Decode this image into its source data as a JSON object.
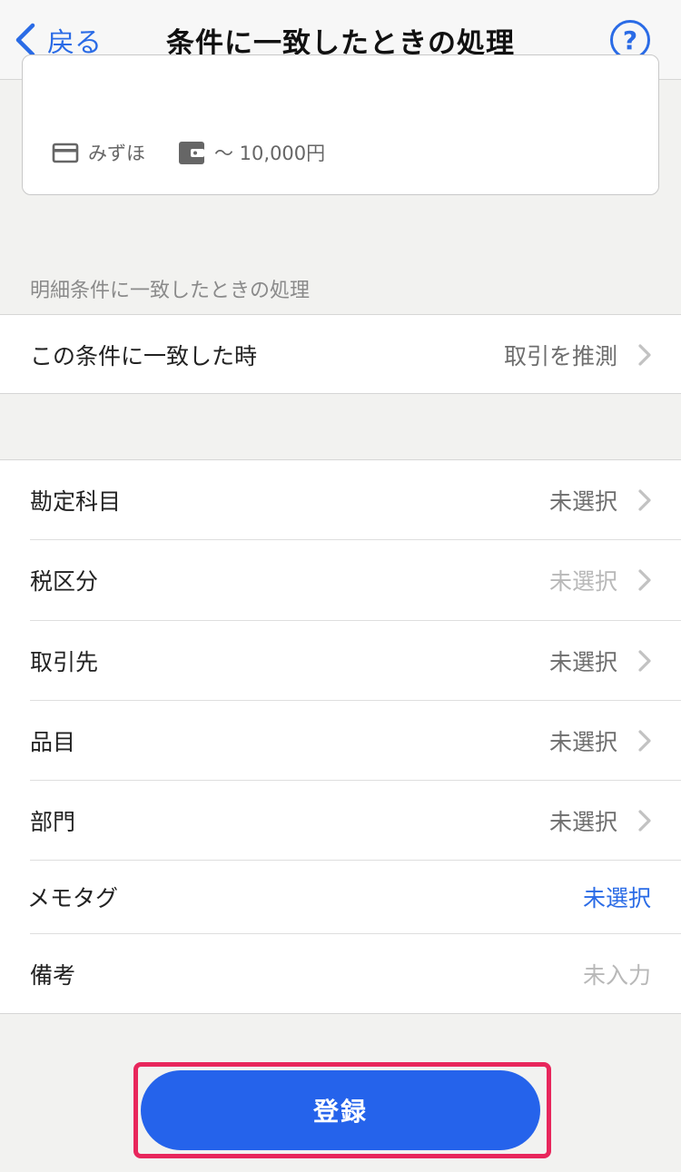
{
  "nav": {
    "back_label": "戻る",
    "title": "条件に一致したときの処理",
    "help_label": "?"
  },
  "card": {
    "bank": "みずほ",
    "amount": "〜 10,000円",
    "bank_icon": "card-icon",
    "amount_icon": "wallet-icon"
  },
  "section": {
    "header": "明細条件に一致したときの処理"
  },
  "match_row": {
    "label": "この条件に一致した時",
    "value": "取引を推測"
  },
  "fields": [
    {
      "label": "勘定科目",
      "value": "未選択"
    },
    {
      "label": "税区分",
      "value": "未選択"
    },
    {
      "label": "取引先",
      "value": "未選択"
    },
    {
      "label": "品目",
      "value": "未選択"
    },
    {
      "label": "部門",
      "value": "未選択"
    },
    {
      "label": "メモタグ",
      "value": "未選択"
    },
    {
      "label": "備考",
      "value": "未入力"
    }
  ],
  "submit": {
    "label": "登録"
  },
  "colors": {
    "accent": "#2a6be6",
    "button": "#2563eb",
    "highlight": "#e8265c"
  }
}
